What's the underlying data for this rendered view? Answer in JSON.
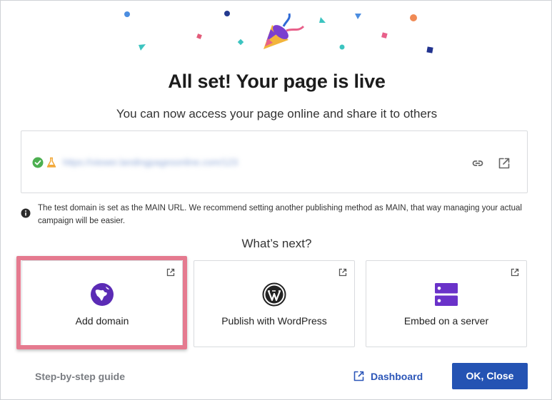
{
  "dialog": {
    "title": "All set! Your page is live",
    "subtitle": "You can now access your page online and share it to others"
  },
  "url_box": {
    "url": "https://viewer.landingpagesonline.com/123",
    "status_icon": "check-circle-icon",
    "test_icon": "flask-icon",
    "status_color": "#4caf50",
    "test_color": "#f2a93b"
  },
  "notice": {
    "text": "The test domain is set as the MAIN URL. We recommend setting another publishing method as MAIN, that way managing your actual campaign will be easier."
  },
  "whats_next": {
    "heading": "What’s next?",
    "cards": [
      {
        "label": "Add domain",
        "icon": "globe-icon",
        "icon_color": "#5b2bb5"
      },
      {
        "label": "Publish with WordPress",
        "icon": "wordpress-icon",
        "icon_color": "#222222"
      },
      {
        "label": "Embed on a server",
        "icon": "server-icon",
        "icon_color": "#6a32c9"
      }
    ]
  },
  "footer": {
    "guide_label": "Step-by-step guide",
    "dashboard_label": "Dashboard",
    "ok_label": "OK, Close"
  },
  "colors": {
    "primary": "#2453b3",
    "highlight": "#e57a8f"
  }
}
